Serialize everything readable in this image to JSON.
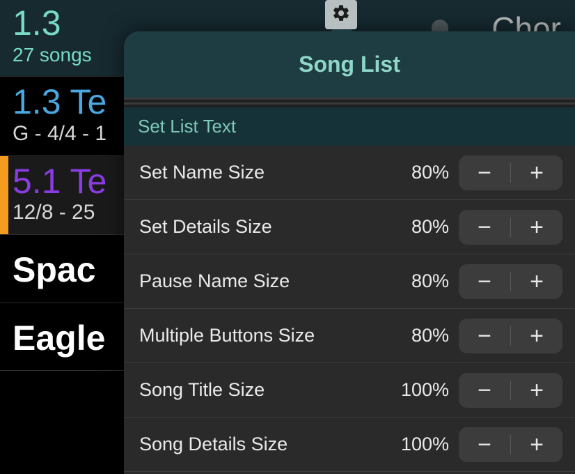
{
  "header": {
    "set_number": "1.3",
    "song_count_label": "27 songs"
  },
  "bg_top_right_text": "Chor",
  "songs": [
    {
      "title": "1.3 Te",
      "details": "G - 4/4 - 1",
      "style": "blue",
      "selected": false
    },
    {
      "title": "5.1 Te",
      "details": "12/8 - 25",
      "style": "purple",
      "selected": true
    },
    {
      "title": "Spac",
      "details": "",
      "style": "plain",
      "selected": false
    },
    {
      "title": "Eagle",
      "details": "",
      "style": "plain",
      "selected": false
    }
  ],
  "popover": {
    "title": "Song List",
    "section_label": "Set List Text",
    "rows": [
      {
        "label": "Set Name Size",
        "value": "80%"
      },
      {
        "label": "Set Details Size",
        "value": "80%"
      },
      {
        "label": "Pause Name Size",
        "value": "80%"
      },
      {
        "label": "Multiple Buttons Size",
        "value": "80%"
      },
      {
        "label": "Song Title Size",
        "value": "100%"
      },
      {
        "label": "Song Details Size",
        "value": "100%"
      }
    ]
  },
  "glyphs": {
    "minus": "−",
    "plus": "+"
  }
}
